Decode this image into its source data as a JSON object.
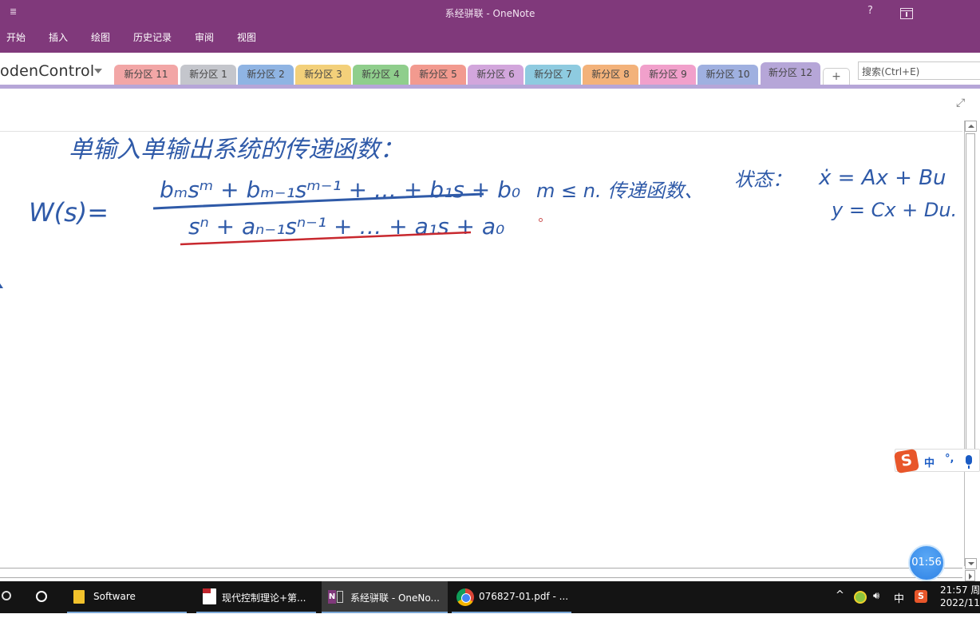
{
  "window": {
    "title": "系经骈联 - OneNote",
    "qat_icon": "customize-quick-access-icon",
    "controls": {
      "help": "?",
      "ribbon_display": "ribbon-display-options-icon"
    }
  },
  "ribbon": {
    "tabs": [
      "开始",
      "插入",
      "绘图",
      "历史记录",
      "审阅",
      "视图"
    ]
  },
  "notebook": {
    "name": "odenControl",
    "sections": [
      {
        "label": "新分区 11",
        "color": "#f2a6a6"
      },
      {
        "label": "新分区 1",
        "color": "#c4c6cc"
      },
      {
        "label": "新分区 2",
        "color": "#8fb4e3"
      },
      {
        "label": "新分区 3",
        "color": "#f3d07a"
      },
      {
        "label": "新分区 4",
        "color": "#8fce8c"
      },
      {
        "label": "新分区 5",
        "color": "#f29a8f"
      },
      {
        "label": "新分区 6",
        "color": "#d2a6dc"
      },
      {
        "label": "新分区 7",
        "color": "#8ecbe0"
      },
      {
        "label": "新分区 8",
        "color": "#f3b27a"
      },
      {
        "label": "新分区 9",
        "color": "#f1a0cb"
      },
      {
        "label": "新分区 10",
        "color": "#9fb0e0"
      },
      {
        "label": "新分区 12",
        "color": "#b6a6d8",
        "active": true
      }
    ],
    "add_section": "+",
    "search_placeholder": "搜索(Ctrl+E)"
  },
  "page": {
    "ink": {
      "heading": "单输入单输出系统的传递函数：",
      "lhs": "W(s)=",
      "numerator": "bₘsᵐ + bₘ₋₁sᵐ⁻¹ + … + b₁s + b₀",
      "denominator": "sⁿ + aₙ₋₁sⁿ⁻¹ + … + a₁s + a₀",
      "condition": "m ≤ n. 传递函数、",
      "state_label": "状态：",
      "state_eq1": "ẋ = Ax + Bu",
      "state_eq2": "y = Cx + Du."
    }
  },
  "ime": {
    "logo": "S",
    "mode": "中",
    "punct": "°,"
  },
  "timer": "01:56",
  "taskbar": {
    "apps": [
      {
        "label": "Software",
        "icon": "folder-icon"
      },
      {
        "label": "现代控制理论+第...",
        "icon": "pdf-icon"
      },
      {
        "label": "系经骈联 - OneNo...",
        "icon": "onenote-icon",
        "active": true
      },
      {
        "label": "076827-01.pdf - ...",
        "icon": "chrome-icon"
      }
    ],
    "tray": {
      "chevron": "^",
      "ime": "中",
      "sogou": "S",
      "time": "21:57 周",
      "date": "2022/11/"
    }
  }
}
